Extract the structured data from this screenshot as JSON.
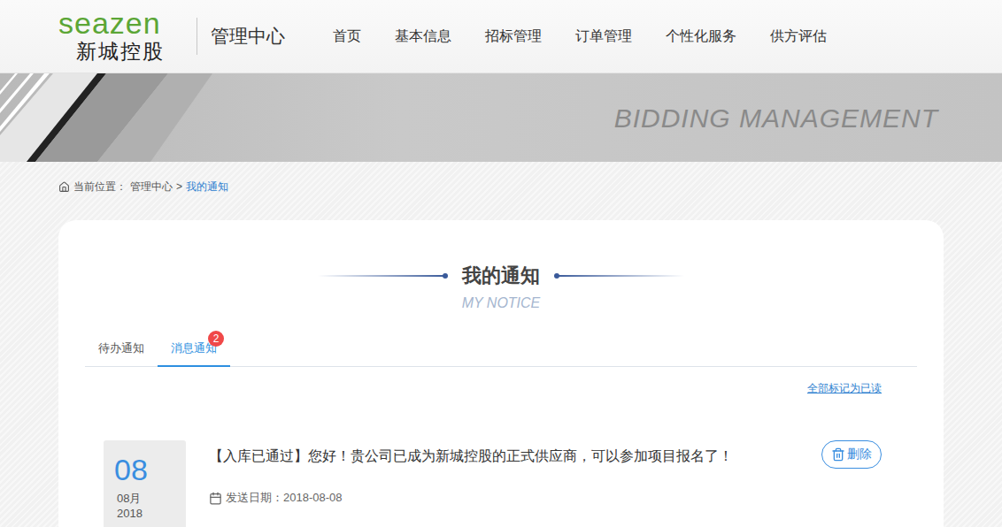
{
  "header": {
    "logo": {
      "brand": "seazen",
      "name": "新城控股"
    },
    "title": "管理中心",
    "nav": [
      {
        "label": "首页",
        "selected": false
      },
      {
        "label": "基本信息",
        "selected": false
      },
      {
        "label": "招标管理",
        "selected": false
      },
      {
        "label": "订单管理",
        "selected": false
      },
      {
        "label": "个性化服务",
        "selected": false
      },
      {
        "label": "供方评估",
        "selected": false
      }
    ]
  },
  "banner": {
    "text": "BIDDING MANAGEMENT"
  },
  "breadcrumb": {
    "label": "当前位置：",
    "separator": ">",
    "items": [
      {
        "label": "管理中心",
        "selected": false
      },
      {
        "label": "我的通知",
        "selected": true
      }
    ]
  },
  "page": {
    "title": "我的通知",
    "subtitle": "MY NOTICE"
  },
  "tabs": [
    {
      "label": "待办通知",
      "selected": false
    },
    {
      "label": "消息通知",
      "selected": true,
      "badge": "2"
    }
  ],
  "mark_all_read": "全部标记为已读",
  "notices": [
    {
      "day": "08",
      "month": "08月",
      "year": "2018",
      "message": "【入库已通过】您好！贵公司已成为新城控股的正式供应商，可以参加项目报名了！",
      "delete": "删除",
      "date_label": "发送日期：",
      "date": "2018-08-08"
    }
  ]
}
